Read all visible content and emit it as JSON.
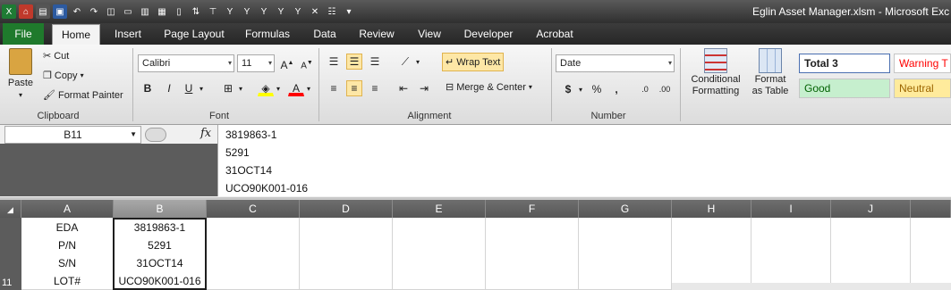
{
  "window": {
    "title": "Eglin Asset Manager.xlsm  -  Microsoft Exc"
  },
  "ribbon_tabs": [
    "File",
    "Home",
    "Insert",
    "Page Layout",
    "Formulas",
    "Data",
    "Review",
    "View",
    "Developer",
    "Acrobat"
  ],
  "active_tab": "Home",
  "clipboard": {
    "paste": "Paste",
    "cut": "Cut",
    "copy": "Copy",
    "format_painter": "Format Painter",
    "label": "Clipboard"
  },
  "font": {
    "name": "Calibri",
    "size": "11",
    "bold": "B",
    "italic": "I",
    "underline": "U",
    "label": "Font"
  },
  "alignment": {
    "wrap_text": "Wrap Text",
    "merge_center": "Merge & Center",
    "label": "Alignment"
  },
  "number": {
    "format": "Date",
    "currency": "$",
    "percent": "%",
    "comma": ",",
    "label": "Number"
  },
  "styles": {
    "conditional": "Conditional",
    "conditional2": "Formatting",
    "format_as": "Format",
    "format_as2": "as Table",
    "total3": "Total 3",
    "warning": "Warning T",
    "good": "Good",
    "neutral": "Neutral"
  },
  "formula_bar": {
    "name_box": "B11",
    "fx": "fx",
    "lines": [
      "3819863-1",
      "5291",
      "31OCT14",
      "UCO90K001-016"
    ]
  },
  "columns": [
    "A",
    "B",
    "C",
    "D",
    "E",
    "F",
    "G",
    "H",
    "I",
    "J"
  ],
  "row_number": "11",
  "cells": {
    "A": [
      "EDA",
      "P/N",
      "S/N",
      "LOT#"
    ],
    "B": [
      "3819863-1",
      "5291",
      "31OCT14",
      "UCO90K001-016"
    ]
  },
  "colors": {
    "file_tab": "#1f7a2c",
    "good_bg": "#c6efce",
    "good_fg": "#006100",
    "neutral_bg": "#ffeb9c",
    "neutral_fg": "#9c6500",
    "warning_fg": "#ff0000"
  }
}
